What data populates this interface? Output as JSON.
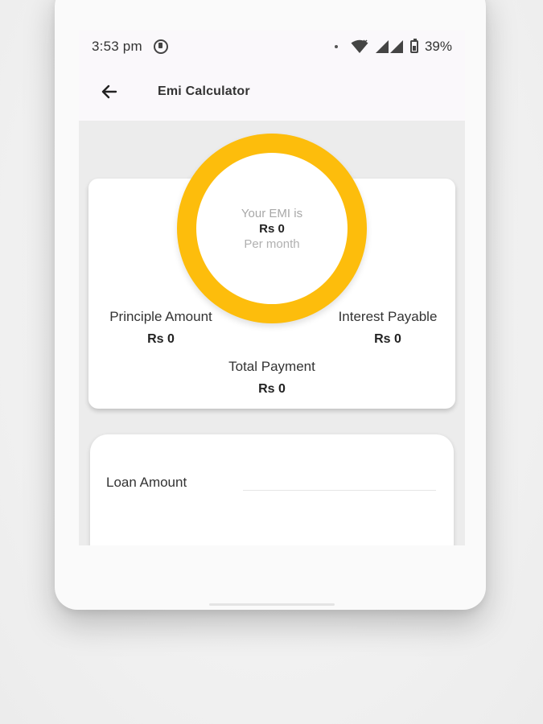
{
  "status_bar": {
    "time": "3:53 pm",
    "battery": "39%"
  },
  "app_bar": {
    "title": "Emi Calculator"
  },
  "emi_ring": {
    "label": "Your EMI is",
    "value": "Rs 0",
    "period": "Per month",
    "ring_color": "#fdbd0c"
  },
  "summary": {
    "principal_label": "Principle Amount",
    "principal_value": "Rs 0",
    "interest_label": "Interest Payable",
    "interest_value": "Rs 0",
    "total_label": "Total Payment",
    "total_value": "Rs 0"
  },
  "form": {
    "loan_amount_label": "Loan Amount",
    "loan_amount_value": ""
  },
  "icons": {
    "back": "arrow-back-icon",
    "app_status": "app-notification-icon",
    "wifi": "wifi-icon",
    "signal": "cellular-signal-icon",
    "battery": "battery-icon"
  }
}
